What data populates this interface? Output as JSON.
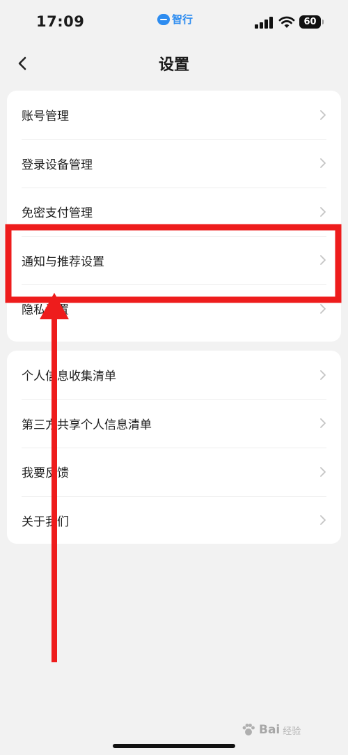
{
  "status_bar": {
    "time": "17:09",
    "app_name": "智行",
    "battery": "60"
  },
  "nav": {
    "title": "设置",
    "back_icon": "chevron-left-icon"
  },
  "group1": {
    "items": [
      {
        "label": "账号管理"
      },
      {
        "label": "登录设备管理"
      },
      {
        "label": "免密支付管理"
      },
      {
        "label": "通知与推荐设置"
      },
      {
        "label": "隐私设置"
      }
    ]
  },
  "group2": {
    "items": [
      {
        "label": "个人信息收集清单"
      },
      {
        "label": "第三方共享个人信息清单"
      },
      {
        "label": "我要反馈"
      },
      {
        "label": "关于我们"
      }
    ]
  },
  "annotation": {
    "highlight_color": "#ee1c1c",
    "highlighted_item": "通知与推荐设置"
  },
  "watermark": {
    "brand": "Bai",
    "sub": "经验"
  },
  "colors": {
    "background": "#f2f2f2",
    "card": "#ffffff",
    "accent": "#2d8cf0"
  }
}
